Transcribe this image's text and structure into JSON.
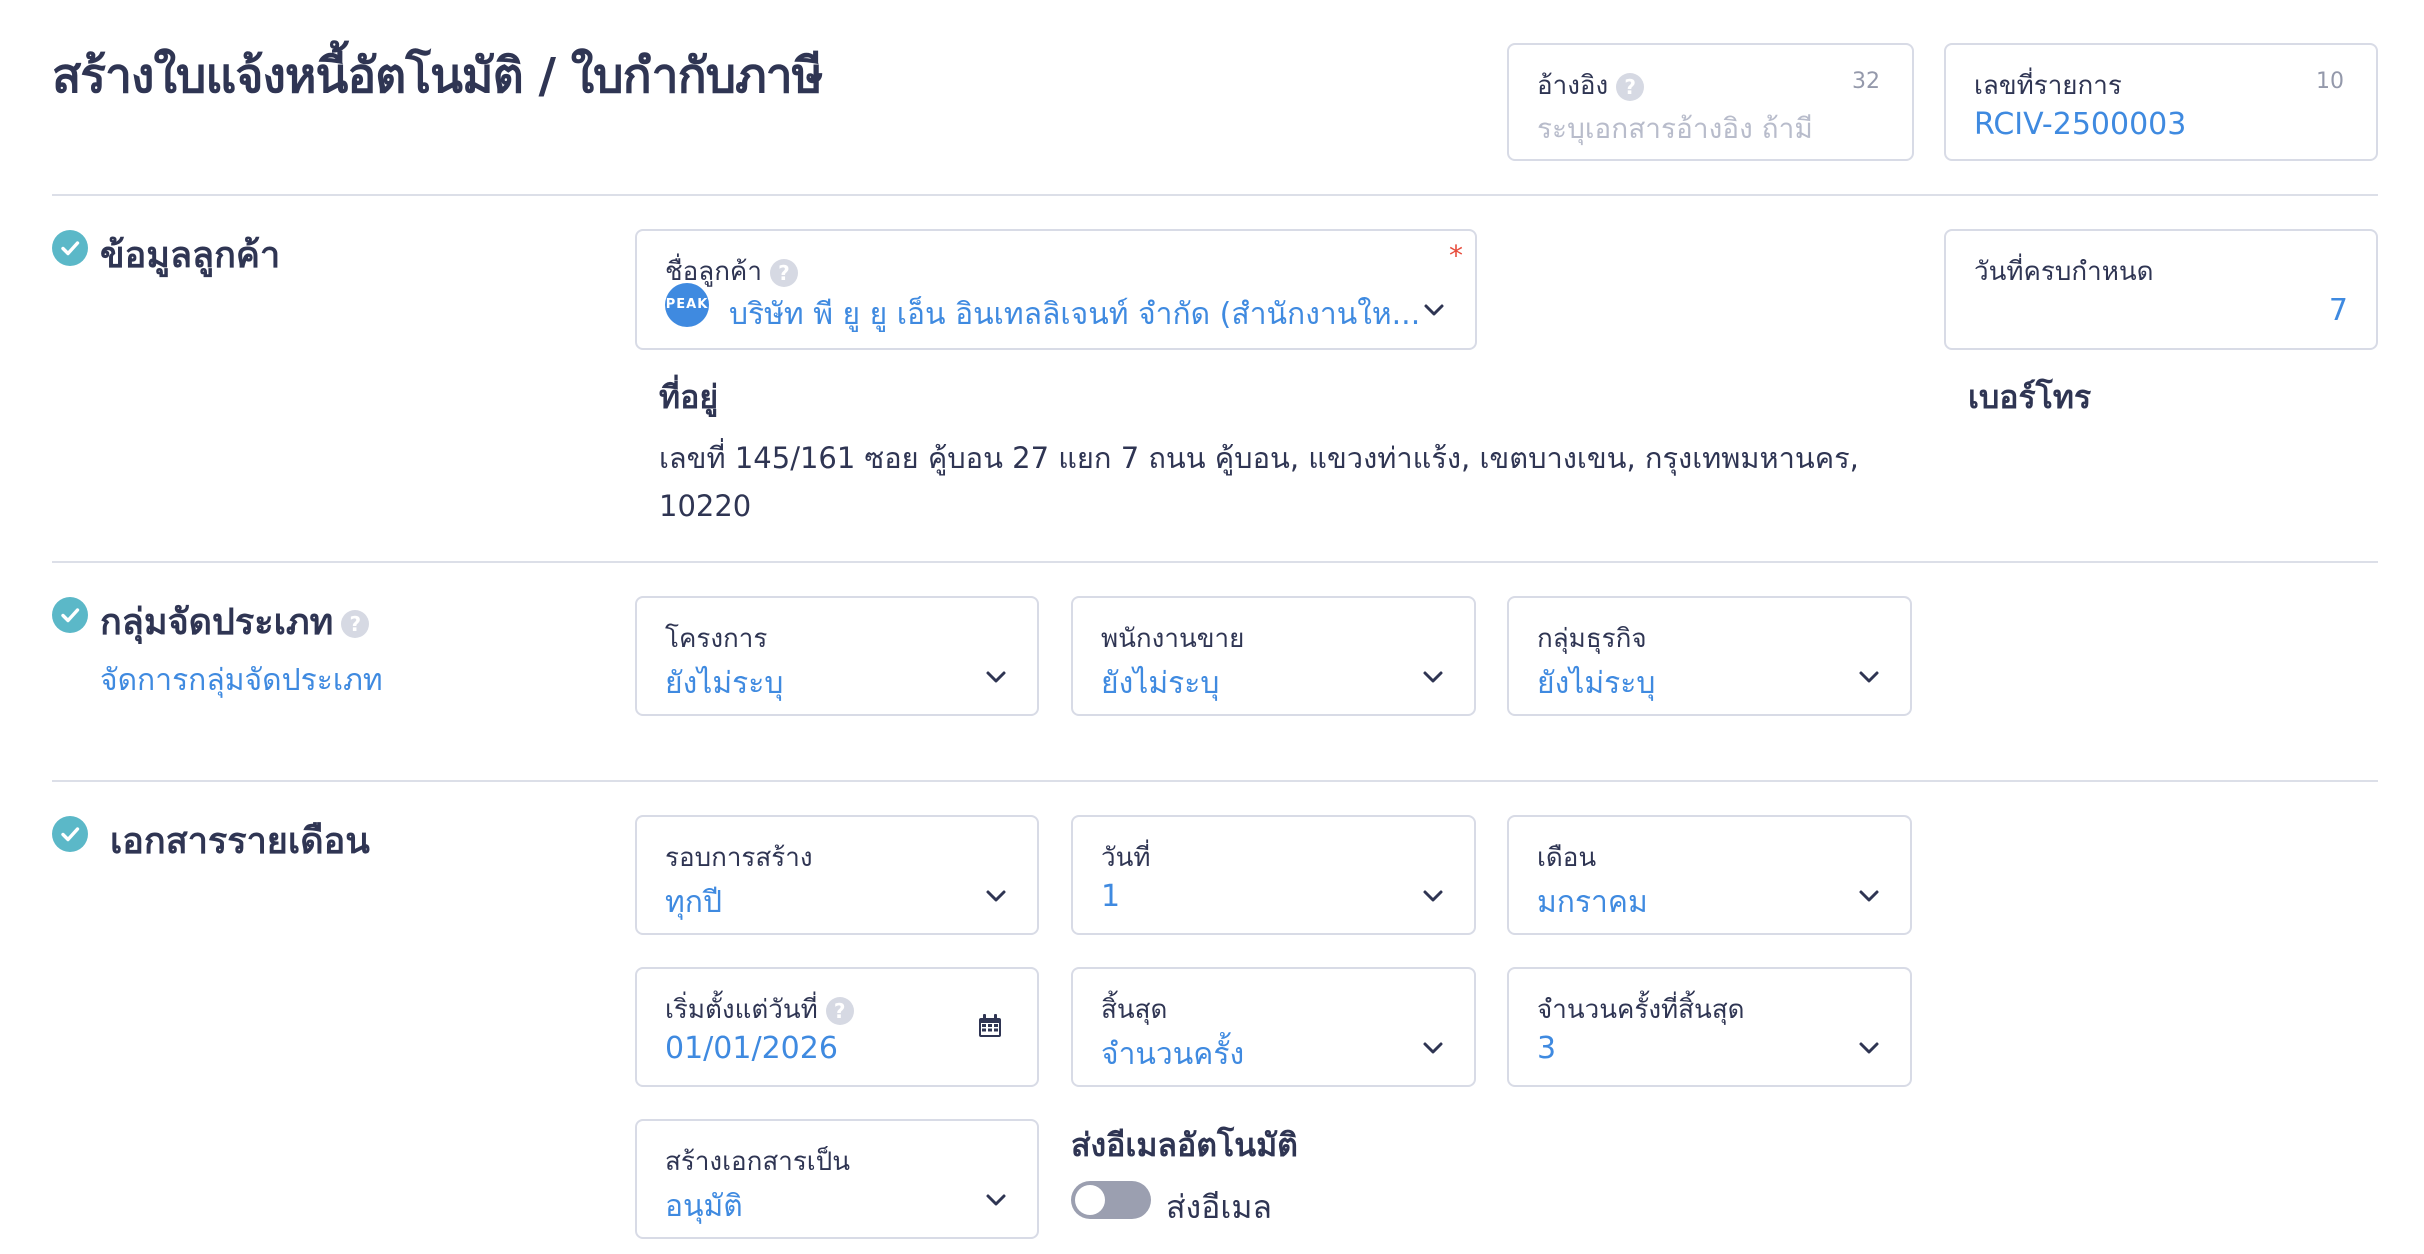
{
  "page": {
    "title": "สร้างใบแจ้งหนี้อัตโนมัติ / ใบกำกับภาษี"
  },
  "header": {
    "reference": {
      "label": "อ้างอิง",
      "counter": "32",
      "placeholder": "ระบุเอกสารอ้างอิง ถ้ามี"
    },
    "doc_number": {
      "label": "เลขที่รายการ",
      "counter": "10",
      "value": "RCIV-2500003"
    }
  },
  "customer_section": {
    "title": "ข้อมูลลูกค้า",
    "customer": {
      "label": "ชื่อลูกค้า",
      "required_mark": "*",
      "avatar_text": "PEAK",
      "value": "บริษัท พี ยู ยู เอ็น อินเทลลิเจนท์ จำกัด (สำนักงานให..."
    },
    "due_date": {
      "label": "วันที่ครบกำหนด",
      "value": "7"
    },
    "address": {
      "label": "ที่อยู่",
      "value": "เลขที่ 145/161 ซอย คู้บอน 27 แยก 7 ถนน คู้บอน, แขวงท่าแร้ง, เขตบางเขน, กรุงเทพมหานคร, 10220"
    },
    "phone": {
      "label": "เบอร์โทร"
    }
  },
  "classification_section": {
    "title": "กลุ่มจัดประเภท",
    "manage_link": "จัดการกลุ่มจัดประเภท",
    "project": {
      "label": "โครงการ",
      "value": "ยังไม่ระบุ"
    },
    "salesperson": {
      "label": "พนักงานขาย",
      "value": "ยังไม่ระบุ"
    },
    "business_group": {
      "label": "กลุ่มธุรกิจ",
      "value": "ยังไม่ระบุ"
    }
  },
  "monthly_section": {
    "title": "เอกสารรายเดือน",
    "cycle": {
      "label": "รอบการสร้าง",
      "value": "ทุกปี"
    },
    "day": {
      "label": "วันที่",
      "value": "1"
    },
    "month": {
      "label": "เดือน",
      "value": "มกราคม"
    },
    "start_date": {
      "label": "เริ่มตั้งแต่วันที่",
      "value": "01/01/2026"
    },
    "end": {
      "label": "สิ้นสุด",
      "value": "จำนวนครั้ง"
    },
    "end_count": {
      "label": "จำนวนครั้งที่สิ้นสุด",
      "value": "3"
    },
    "create_as": {
      "label": "สร้างเอกสารเป็น",
      "value": "อนุมัติ"
    },
    "auto_email": {
      "title": "ส่งอีเมลอัตโนมัติ",
      "toggle_label": "ส่งอีเมล",
      "enabled": false
    }
  },
  "colors": {
    "accent": "#3f8ae0",
    "check": "#5bb8c8",
    "required": "#e74c3c",
    "toggle_off": "#9b9fb0"
  }
}
